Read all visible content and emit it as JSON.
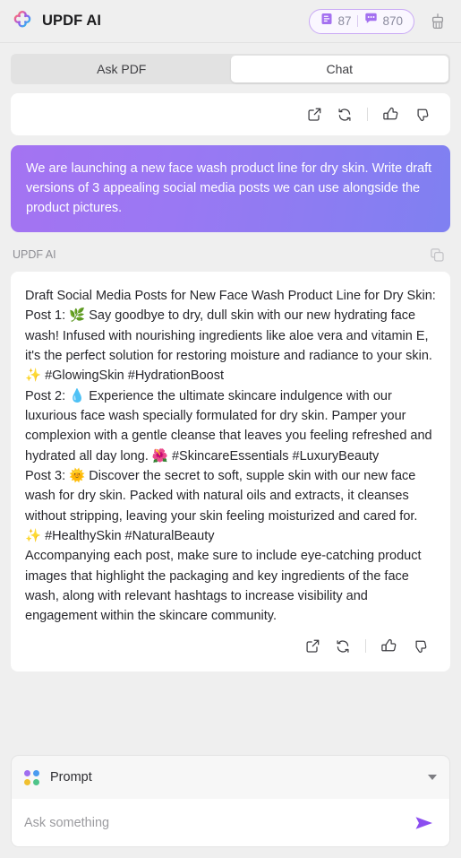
{
  "header": {
    "logo_icon": "updf-clover-logo-icon",
    "title": "UPDF AI",
    "stats": {
      "pages_icon": "document-pages-icon",
      "pages_value": "87",
      "messages_icon": "chat-bubble-icon",
      "messages_value": "870",
      "border_color": "#c9a9f5",
      "accent_color": "#a471f0"
    },
    "clear_icon": "broom-clear-chat-icon"
  },
  "tabs": [
    {
      "label": "Ask PDF",
      "active": false,
      "name": "tab-ask-pdf"
    },
    {
      "label": "Chat",
      "active": true,
      "name": "tab-chat"
    }
  ],
  "actions": {
    "share_icon": "external-link-icon",
    "regenerate_icon": "refresh-regenerate-icon",
    "like_icon": "thumbs-up-icon",
    "dislike_icon": "thumbs-down-icon"
  },
  "conversation": {
    "user_message": {
      "text": "We are launching a new face wash product line for dry skin. Write draft versions of 3 appealing social media posts we can use alongside the product pictures.",
      "gradient_from": "#a473f2",
      "gradient_to": "#7f80f1"
    },
    "assistant": {
      "name": "UPDF AI",
      "copy_icon": "copy-icon",
      "lines": [
        {
          "text": "Draft Social Media Posts for New Face Wash Product Line for Dry Skin:"
        },
        {
          "prefix": "Post 1: ",
          "emoji": "🌿",
          "text": " Say goodbye to dry, dull skin with our new hydrating face wash! Infused with nourishing ingredients like aloe vera and vitamin E, it's the perfect solution for restoring moisture and radiance to your skin. ",
          "emoji2": "✨",
          "text2": " #GlowingSkin #HydrationBoost"
        },
        {
          "prefix": "Post 2: ",
          "emoji": "💧",
          "text": " Experience the ultimate skincare indulgence with our luxurious face wash specially formulated for dry skin. Pamper your complexion with a gentle cleanse that leaves you feeling refreshed and hydrated all day long. ",
          "emoji2": "🌺",
          "text2": " #SkincareEssentials #LuxuryBeauty"
        },
        {
          "prefix": "Post 3: ",
          "emoji": "🌞",
          "text": " Discover the secret to soft, supple skin with our new face wash for dry skin. Packed with natural oils and extracts, it cleanses without stripping, leaving your skin feeling moisturized and cared for. ",
          "emoji2": "✨",
          "text2": " #HealthySkin #NaturalBeauty"
        },
        {
          "text": "Accompanying each post, make sure to include eye-catching product images that highlight the packaging and key ingredients of the face wash, along with relevant hashtags to increase visibility and engagement within the skincare community."
        }
      ]
    }
  },
  "composer": {
    "prompt_icon": "four-dots-prompt-icon",
    "prompt_label": "Prompt",
    "dropdown_icon": "chevron-down-icon",
    "input_value": "",
    "input_placeholder": "Ask something",
    "send_icon": "send-paper-plane-icon",
    "send_color": "#8b4df0",
    "dot_colors": [
      "#a06ef0",
      "#4a9bf0",
      "#f0c030",
      "#4fc48a"
    ]
  }
}
